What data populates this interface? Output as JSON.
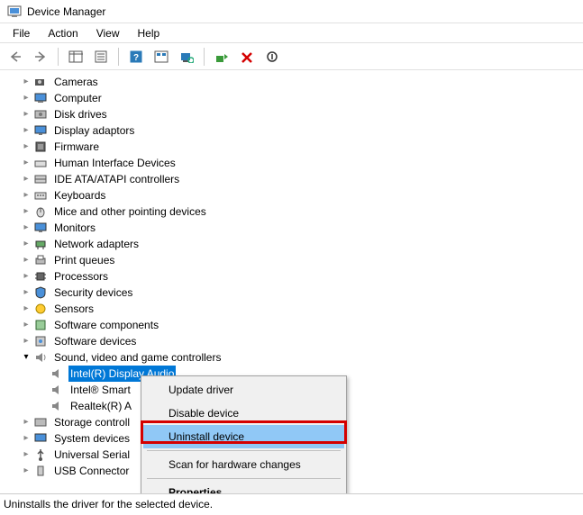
{
  "window": {
    "title": "Device Manager"
  },
  "menu": {
    "file": "File",
    "action": "Action",
    "view": "View",
    "help": "Help"
  },
  "tree": {
    "cameras": "Cameras",
    "computer": "Computer",
    "disk": "Disk drives",
    "display": "Display adaptors",
    "firmware": "Firmware",
    "hid": "Human Interface Devices",
    "ide": "IDE ATA/ATAPI controllers",
    "keyboards": "Keyboards",
    "mice": "Mice and other pointing devices",
    "monitors": "Monitors",
    "network": "Network adapters",
    "printq": "Print queues",
    "processors": "Processors",
    "security": "Security devices",
    "sensors": "Sensors",
    "swcomp": "Software components",
    "swdev": "Software devices",
    "sound": "Sound, video and game controllers",
    "sound_intel_display": "Intel(R) Display Audio",
    "sound_intel_smart": "Intel® Smart",
    "sound_realtek": "Realtek(R) A",
    "storage": "Storage controll",
    "sysdev": "System devices",
    "usb": "Universal Serial",
    "usbconn": "USB Connector"
  },
  "context": {
    "update": "Update driver",
    "disable": "Disable device",
    "uninstall": "Uninstall device",
    "scan": "Scan for hardware changes",
    "properties": "Properties"
  },
  "status": "Uninstalls the driver for the selected device."
}
